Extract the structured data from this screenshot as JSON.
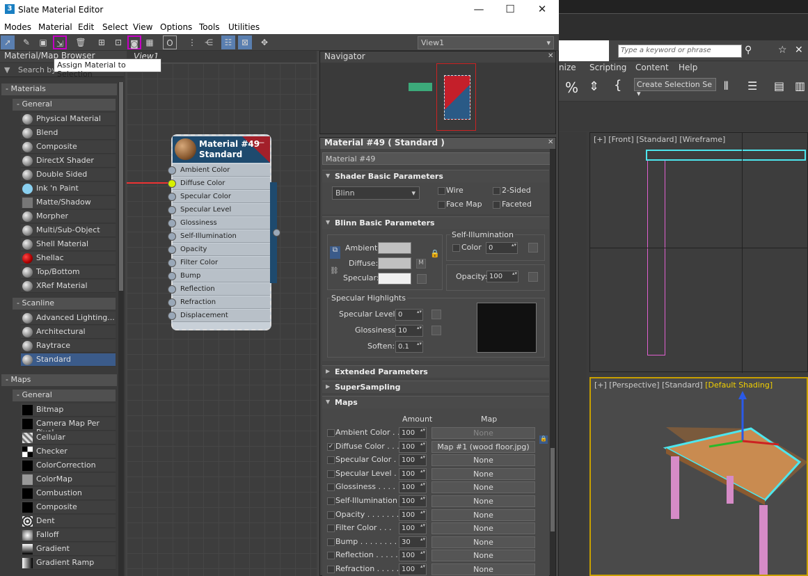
{
  "window": {
    "title": "Slate Material Editor",
    "icon": "3"
  },
  "menubar": [
    "Modes",
    "Material",
    "Edit",
    "Select",
    "View",
    "Options",
    "Tools",
    "Utilities"
  ],
  "toolbar": {
    "view_select": "View1",
    "tooltip": "Assign Material to Selection"
  },
  "browser": {
    "title": "Material/Map Browser",
    "search_placeholder": "Search by Name ...",
    "materials_header": "Materials",
    "general_header": "General",
    "general_items": [
      "Physical Material",
      "Blend",
      "Composite",
      "DirectX Shader",
      "Double Sided",
      "Ink 'n Paint",
      "Matte/Shadow",
      "Morpher",
      "Multi/Sub-Object",
      "Shell Material",
      "Shellac",
      "Top/Bottom",
      "XRef Material"
    ],
    "scanline_header": "Scanline",
    "scanline_items": [
      "Advanced Lighting...",
      "Architectural",
      "Raytrace",
      "Standard"
    ],
    "maps_header": "Maps",
    "maps_general_header": "General",
    "maps_items": [
      "Bitmap",
      "Camera Map Per Pixel",
      "Cellular",
      "Checker",
      "ColorCorrection",
      "ColorMap",
      "Combustion",
      "Composite",
      "Dent",
      "Falloff",
      "Gradient",
      "Gradient Ramp"
    ]
  },
  "view": {
    "tab": "View1",
    "node": {
      "title_line1": "Material #49",
      "title_line2": "Standard",
      "slots": [
        "Ambient Color",
        "Diffuse Color",
        "Specular Color",
        "Specular Level",
        "Glossiness",
        "Self-Illumination",
        "Opacity",
        "Filter Color",
        "Bump",
        "Reflection",
        "Refraction",
        "Displacement"
      ]
    }
  },
  "navigator": {
    "title": "Navigator"
  },
  "params": {
    "title": "Material #49  ( Standard )",
    "name": "Material #49",
    "shader_rollout": "Shader Basic Parameters",
    "shader": "Blinn",
    "wire": "Wire",
    "two_sided": "2-Sided",
    "face_map": "Face Map",
    "faceted": "Faceted",
    "blinn_rollout": "Blinn Basic Parameters",
    "ambient": "Ambient:",
    "diffuse": "Diffuse:",
    "specular": "Specular:",
    "m_button": "M",
    "self_illum": "Self-Illumination",
    "color": "Color",
    "color_value": "0",
    "opacity": "Opacity:",
    "opacity_value": "100",
    "spec_highlights": "Specular Highlights",
    "spec_level": "Specular Level:",
    "spec_level_value": "0",
    "glossiness": "Glossiness:",
    "glossiness_value": "10",
    "soften": "Soften:",
    "soften_value": "0.1",
    "extended_rollout": "Extended Parameters",
    "supersampling_rollout": "SuperSampling",
    "maps_rollout": "Maps",
    "amount_header": "Amount",
    "map_header": "Map",
    "maps": [
      {
        "name": "Ambient Color . .",
        "amount": "100",
        "map": "None",
        "checked": false
      },
      {
        "name": "Diffuse Color . . .",
        "amount": "100",
        "map": "Map #1 (wood floor.jpg)",
        "checked": true
      },
      {
        "name": "Specular Color . .",
        "amount": "100",
        "map": "None",
        "checked": false
      },
      {
        "name": "Specular Level . .",
        "amount": "100",
        "map": "None",
        "checked": false
      },
      {
        "name": "Glossiness . . . .",
        "amount": "100",
        "map": "None",
        "checked": false
      },
      {
        "name": "Self-Illumination . .",
        "amount": "100",
        "map": "None",
        "checked": false
      },
      {
        "name": "Opacity . . . . . . .",
        "amount": "100",
        "map": "None",
        "checked": false
      },
      {
        "name": "Filter Color . . .",
        "amount": "100",
        "map": "None",
        "checked": false
      },
      {
        "name": "Bump . . . . . . . .",
        "amount": "30",
        "map": "None",
        "checked": false
      },
      {
        "name": "Reflection . . . . .",
        "amount": "100",
        "map": "None",
        "checked": false
      },
      {
        "name": "Refraction . . . . .",
        "amount": "100",
        "map": "None",
        "checked": false
      }
    ]
  },
  "background_app": {
    "search_placeholder": "Type a keyword or phrase",
    "menu": [
      "nize",
      "Scripting",
      "Content",
      "Help"
    ],
    "selection_set": "Create Selection Se",
    "vp_front_label": "[+] [Front] [Standard] [Wireframe]",
    "vp_persp_label": "[+] [Perspective] [Standard]",
    "vp_persp_shading": "[Default Shading]"
  },
  "colors": {
    "accent": "#c400c4",
    "node_header": "#1e4a6e",
    "node_red": "#a3202a",
    "active_pin": "#d8f000"
  }
}
